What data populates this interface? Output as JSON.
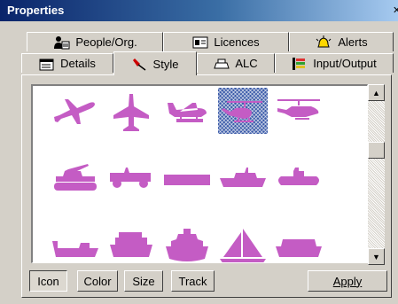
{
  "window": {
    "title": "Properties"
  },
  "tabs": {
    "row1": [
      {
        "label": "People/Org.",
        "icon": "people-icon"
      },
      {
        "label": "Licences",
        "icon": "licence-icon"
      },
      {
        "label": "Alerts",
        "icon": "alert-icon"
      }
    ],
    "row2": [
      {
        "label": "Details",
        "icon": "details-icon"
      },
      {
        "label": "Style",
        "icon": "pin-icon",
        "active": true
      },
      {
        "label": "ALC",
        "icon": "printer-icon"
      },
      {
        "label": "Input/Output",
        "icon": "io-icon"
      }
    ]
  },
  "gallery": {
    "icon_color": "#c45cc4",
    "selected_index": 3,
    "icons": [
      "airliner-icon",
      "fighter-jet-icon",
      "seaplane-icon",
      "helicopter-icon",
      "attack-helicopter-icon",
      "tank-icon",
      "jeep-icon",
      "barge-icon",
      "patrol-boat-icon",
      "submarine-icon",
      "cargo-ship-icon",
      "ferry-icon",
      "cruise-ship-icon",
      "sailboat-icon",
      "liner-icon"
    ]
  },
  "buttons": {
    "icon": "Icon",
    "color": "Color",
    "size": "Size",
    "track": "Track",
    "apply": "Apply"
  }
}
